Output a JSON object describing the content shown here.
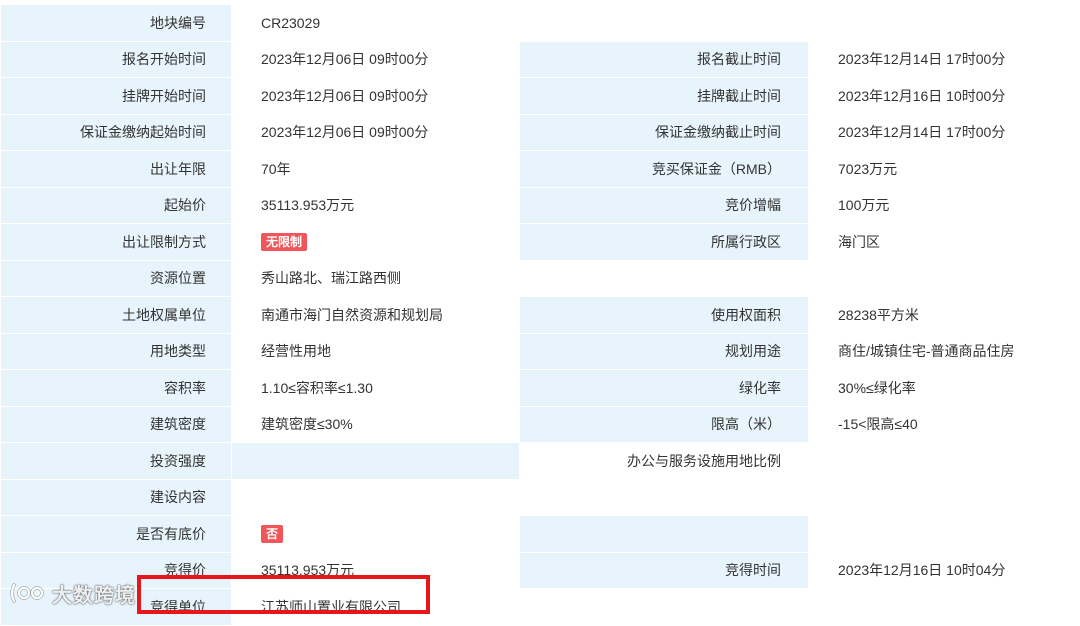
{
  "rows": [
    {
      "l1": "地块编号",
      "v1": "CR23029"
    },
    {
      "l1": "报名开始时间",
      "v1": "2023年12月06日 09时00分",
      "l2": "报名截止时间",
      "v2": "2023年12月14日 17时00分"
    },
    {
      "l1": "挂牌开始时间",
      "v1": "2023年12月06日 09时00分",
      "l2": "挂牌截止时间",
      "v2": "2023年12月16日 10时00分"
    },
    {
      "l1": "保证金缴纳起始时间",
      "v1": "2023年12月06日 09时00分",
      "l2": "保证金缴纳截止时间",
      "v2": "2023年12月14日 17时00分"
    },
    {
      "l1": "出让年限",
      "v1": "70年",
      "l2": "竞买保证金（RMB）",
      "v2": "7023万元"
    },
    {
      "l1": "起始价",
      "v1": "35113.953万元",
      "l2": "竞价增幅",
      "v2": "100万元"
    },
    {
      "l1": "出让限制方式",
      "tag1": "无限制",
      "l2": "所属行政区",
      "v2": "海门区"
    },
    {
      "l1": "资源位置",
      "v1": "秀山路北、瑞江路西侧"
    },
    {
      "l1": "土地权属单位",
      "v1": "南通市海门自然资源和规划局",
      "l2": "使用权面积",
      "v2": "28238平方米"
    },
    {
      "l1": "用地类型",
      "v1": "经营性用地",
      "l2": "规划用途",
      "v2": "商住/城镇住宅-普通商品住房"
    },
    {
      "l1": "容积率",
      "v1": "1.10≤容积率≤1.30",
      "l2": "绿化率",
      "v2": "30%≤绿化率"
    },
    {
      "l1": "建筑密度",
      "v1": "建筑密度≤30%",
      "l2": "限高（米）",
      "v2": "-15<限高≤40"
    },
    {
      "l1": "投资强度",
      "v1": "",
      "l2": "办公与服务设施用地比例",
      "v2": ""
    },
    {
      "l1": "建设内容",
      "v1": ""
    },
    {
      "l1": "是否有底价",
      "tag1": "否",
      "l2": "",
      "v2": ""
    },
    {
      "l1": "竞得价",
      "v1": "35113.953万元",
      "l2": "竞得时间",
      "v2": "2023年12月16日 10时04分"
    },
    {
      "l1": "竞得单位",
      "v1": "江苏师山置业有限公司",
      "l2": "",
      "v2": ""
    }
  ],
  "watermark": {
    "text": "大数跨境"
  },
  "colors": {
    "label_bg": "#e8f4fc",
    "tag_red": "#f0555a",
    "highlight": "#e8151b"
  }
}
